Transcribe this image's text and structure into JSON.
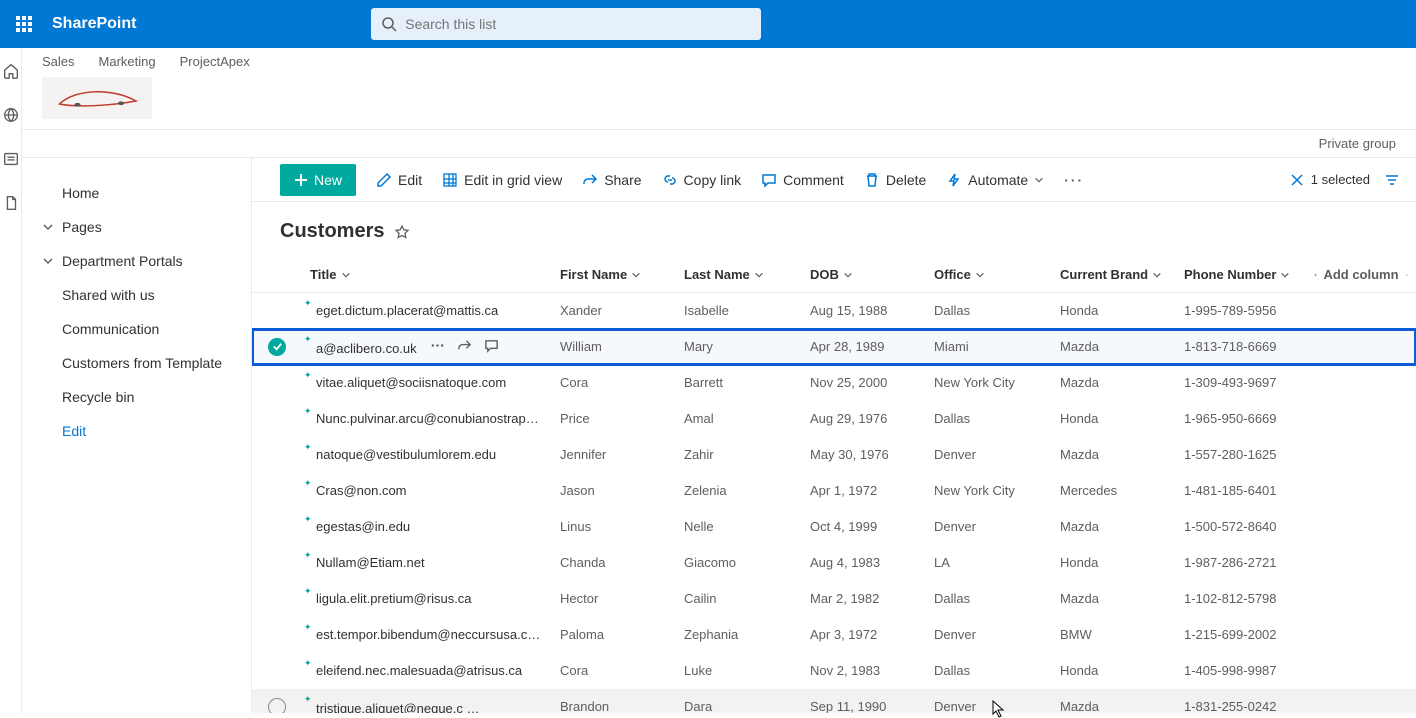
{
  "brand": "SharePoint",
  "search_placeholder": "Search this list",
  "site_links": [
    "Sales",
    "Marketing",
    "ProjectApex"
  ],
  "privacy": "Private group",
  "nav": {
    "home": "Home",
    "pages": "Pages",
    "dept": "Department Portals",
    "shared": "Shared with us",
    "comm": "Communication",
    "custs": "Customers from Template",
    "recycle": "Recycle bin",
    "edit": "Edit"
  },
  "commands": {
    "new": "New",
    "edit": "Edit",
    "gridview": "Edit in grid view",
    "share": "Share",
    "copylink": "Copy link",
    "comment": "Comment",
    "delete": "Delete",
    "automate": "Automate",
    "selected": "1 selected"
  },
  "list_title": "Customers",
  "columns": {
    "title": "Title",
    "first": "First Name",
    "last": "Last Name",
    "dob": "DOB",
    "office": "Office",
    "brand": "Current Brand",
    "phone": "Phone Number",
    "add": "Add column"
  },
  "rows": [
    {
      "title": "eget.dictum.placerat@mattis.ca",
      "first": "Xander",
      "last": "Isabelle",
      "dob": "Aug 15, 1988",
      "office": "Dallas",
      "brand": "Honda",
      "phone": "1-995-789-5956",
      "selected": false,
      "hover": false
    },
    {
      "title": "a@aclibero.co.uk",
      "first": "William",
      "last": "Mary",
      "dob": "Apr 28, 1989",
      "office": "Miami",
      "brand": "Mazda",
      "phone": "1-813-718-6669",
      "selected": true,
      "hover": false
    },
    {
      "title": "vitae.aliquet@sociisnatoque.com",
      "first": "Cora",
      "last": "Barrett",
      "dob": "Nov 25, 2000",
      "office": "New York City",
      "brand": "Mazda",
      "phone": "1-309-493-9697",
      "selected": false,
      "hover": false
    },
    {
      "title": "Nunc.pulvinar.arcu@conubianostraper.edu",
      "first": "Price",
      "last": "Amal",
      "dob": "Aug 29, 1976",
      "office": "Dallas",
      "brand": "Honda",
      "phone": "1-965-950-6669",
      "selected": false,
      "hover": false
    },
    {
      "title": "natoque@vestibulumlorem.edu",
      "first": "Jennifer",
      "last": "Zahir",
      "dob": "May 30, 1976",
      "office": "Denver",
      "brand": "Mazda",
      "phone": "1-557-280-1625",
      "selected": false,
      "hover": false
    },
    {
      "title": "Cras@non.com",
      "first": "Jason",
      "last": "Zelenia",
      "dob": "Apr 1, 1972",
      "office": "New York City",
      "brand": "Mercedes",
      "phone": "1-481-185-6401",
      "selected": false,
      "hover": false
    },
    {
      "title": "egestas@in.edu",
      "first": "Linus",
      "last": "Nelle",
      "dob": "Oct 4, 1999",
      "office": "Denver",
      "brand": "Mazda",
      "phone": "1-500-572-8640",
      "selected": false,
      "hover": false
    },
    {
      "title": "Nullam@Etiam.net",
      "first": "Chanda",
      "last": "Giacomo",
      "dob": "Aug 4, 1983",
      "office": "LA",
      "brand": "Honda",
      "phone": "1-987-286-2721",
      "selected": false,
      "hover": false
    },
    {
      "title": "ligula.elit.pretium@risus.ca",
      "first": "Hector",
      "last": "Cailin",
      "dob": "Mar 2, 1982",
      "office": "Dallas",
      "brand": "Mazda",
      "phone": "1-102-812-5798",
      "selected": false,
      "hover": false
    },
    {
      "title": "est.tempor.bibendum@neccursusa.com",
      "first": "Paloma",
      "last": "Zephania",
      "dob": "Apr 3, 1972",
      "office": "Denver",
      "brand": "BMW",
      "phone": "1-215-699-2002",
      "selected": false,
      "hover": false
    },
    {
      "title": "eleifend.nec.malesuada@atrisus.ca",
      "first": "Cora",
      "last": "Luke",
      "dob": "Nov 2, 1983",
      "office": "Dallas",
      "brand": "Honda",
      "phone": "1-405-998-9987",
      "selected": false,
      "hover": false
    },
    {
      "title": "tristique.aliquet@neque.c",
      "first": "Brandon",
      "last": "Dara",
      "dob": "Sep 11, 1990",
      "office": "Denver",
      "brand": "Mazda",
      "phone": "1-831-255-0242",
      "selected": false,
      "hover": true
    }
  ]
}
